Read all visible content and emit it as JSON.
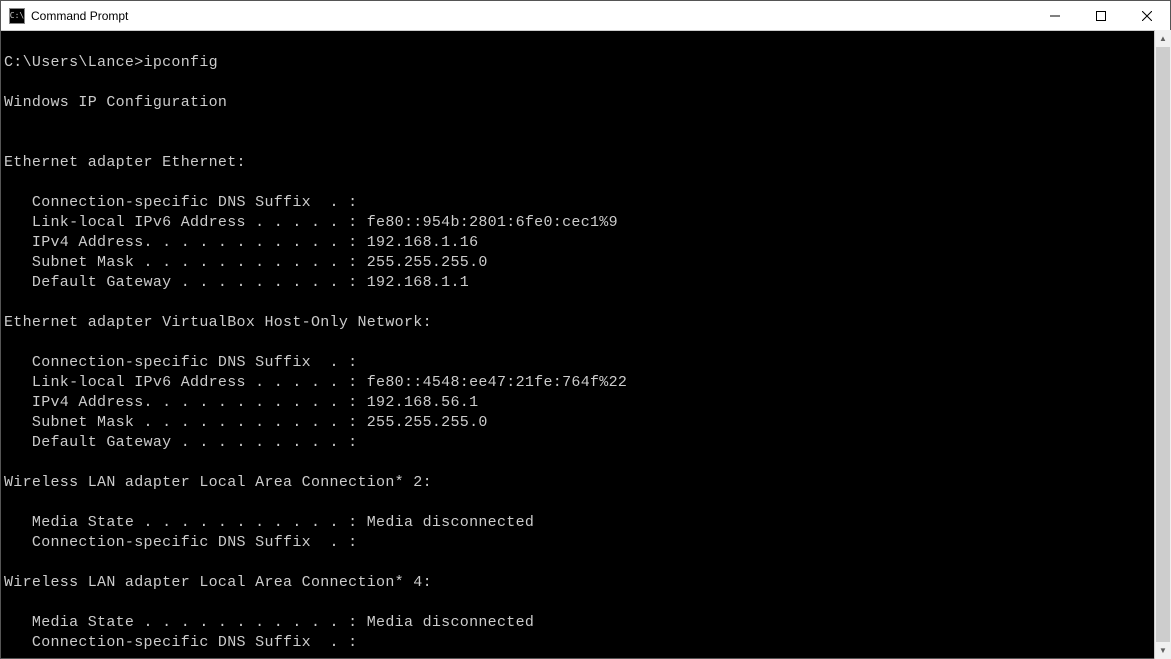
{
  "window": {
    "title": "Command Prompt",
    "icon_label": "C:\\"
  },
  "terminal": {
    "prompt": "C:\\Users\\Lance>",
    "command": "ipconfig",
    "header": "Windows IP Configuration",
    "adapters": [
      {
        "name": "Ethernet adapter Ethernet:",
        "lines": [
          "   Connection-specific DNS Suffix  . :",
          "   Link-local IPv6 Address . . . . . : fe80::954b:2801:6fe0:cec1%9",
          "   IPv4 Address. . . . . . . . . . . : 192.168.1.16",
          "   Subnet Mask . . . . . . . . . . . : 255.255.255.0",
          "   Default Gateway . . . . . . . . . : 192.168.1.1"
        ]
      },
      {
        "name": "Ethernet adapter VirtualBox Host-Only Network:",
        "lines": [
          "   Connection-specific DNS Suffix  . :",
          "   Link-local IPv6 Address . . . . . : fe80::4548:ee47:21fe:764f%22",
          "   IPv4 Address. . . . . . . . . . . : 192.168.56.1",
          "   Subnet Mask . . . . . . . . . . . : 255.255.255.0",
          "   Default Gateway . . . . . . . . . :"
        ]
      },
      {
        "name": "Wireless LAN adapter Local Area Connection* 2:",
        "lines": [
          "   Media State . . . . . . . . . . . : Media disconnected",
          "   Connection-specific DNS Suffix  . :"
        ]
      },
      {
        "name": "Wireless LAN adapter Local Area Connection* 4:",
        "lines": [
          "   Media State . . . . . . . . . . . : Media disconnected",
          "   Connection-specific DNS Suffix  . :"
        ]
      }
    ]
  }
}
